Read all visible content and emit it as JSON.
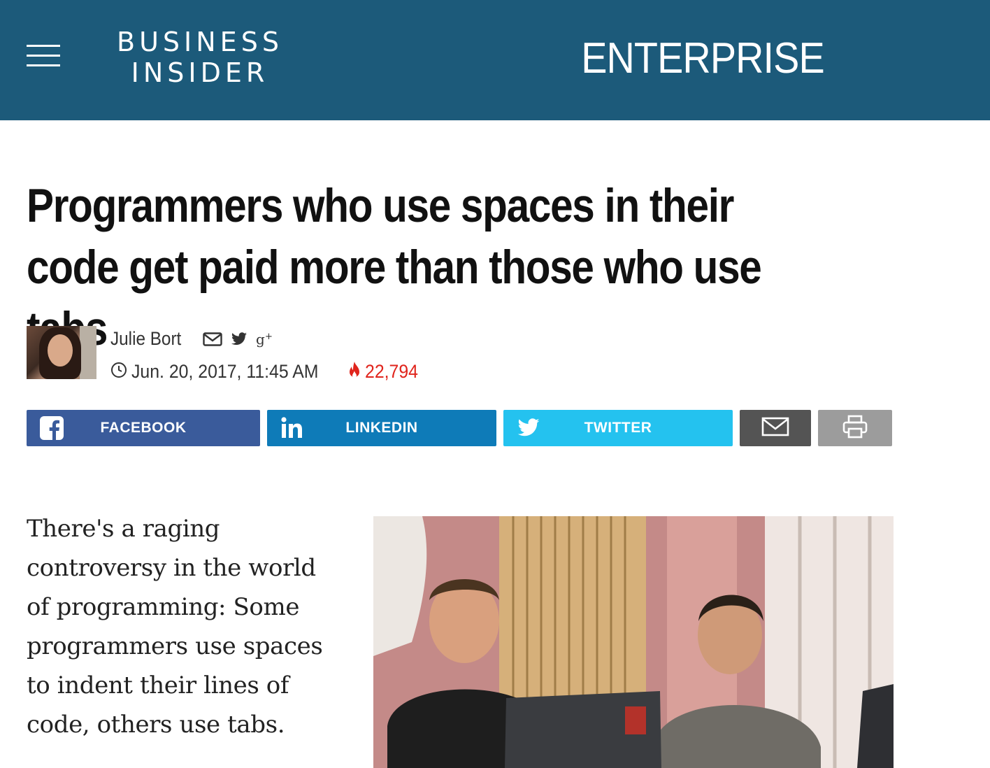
{
  "header": {
    "menu_icon": "hamburger-menu-icon",
    "logo_line1": "BUSINESS",
    "logo_line2": "INSIDER",
    "section": "ENTERPRISE",
    "background_color": "#1c5a7a"
  },
  "article": {
    "headline": "Programmers who use spaces in their code get paid more than those who use tabs",
    "author": {
      "name": "Julie Bort",
      "contact_icons": [
        "email-icon",
        "twitter-icon",
        "google-plus-icon"
      ]
    },
    "date": "Jun. 20, 2017, 11:45 AM",
    "views": "22,794",
    "body_paragraph": "There's a raging controversy in the world of programming: Some programmers use spaces to indent their lines of code, others use tabs."
  },
  "share": {
    "facebook": "FACEBOOK",
    "linkedin": "LINKEDIN",
    "twitter": "TWITTER",
    "colors": {
      "facebook": "#3a5b9b",
      "linkedin": "#0e7bb8",
      "twitter": "#24c2ef",
      "email": "#545454",
      "print": "#9c9c9c"
    }
  },
  "accent": {
    "views_color": "#e0241c"
  }
}
